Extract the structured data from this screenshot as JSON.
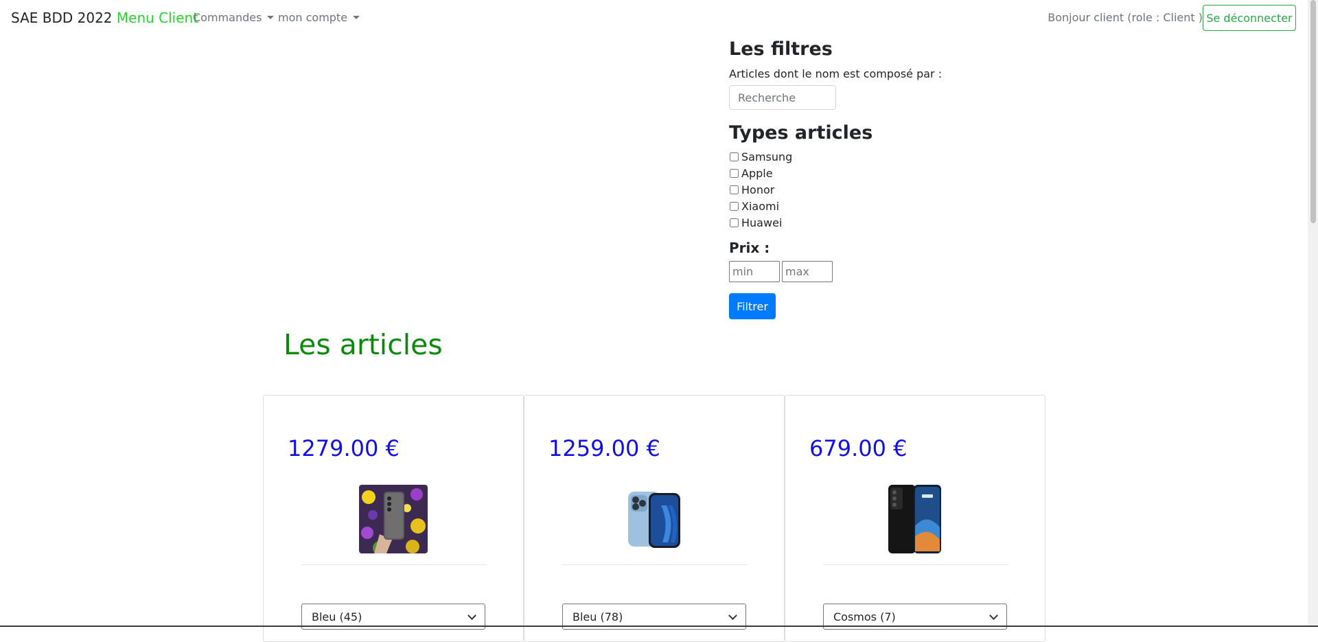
{
  "navbar": {
    "brand_main": "SAE BDD 2022",
    "brand_accent": "Menu Client",
    "menu_commandes": "Commandes",
    "menu_compte": "mon compte",
    "greeting": "Bonjour client (role : Client )",
    "logout_label": "Se déconnecter"
  },
  "filters": {
    "title": "Les filtres",
    "name_label": "Articles dont le nom est composé par :",
    "search_placeholder": "Recherche",
    "types_title": "Types articles",
    "types": [
      "Samsung",
      "Apple",
      "Honor",
      "Xiaomi",
      "Huawei"
    ],
    "price_title": "Prix :",
    "min_placeholder": "min",
    "max_placeholder": "max",
    "filter_button": "Filtrer"
  },
  "articles": {
    "title": "Les articles",
    "items": [
      {
        "price": "1279.00 €",
        "image": "samsung-phone-photo",
        "selected_color": "Bleu (45)"
      },
      {
        "price": "1259.00 €",
        "image": "iphone-photo",
        "selected_color": "Bleu (78)"
      },
      {
        "price": "679.00 €",
        "image": "huawei-phone-photo",
        "selected_color": "Cosmos (7)"
      }
    ]
  },
  "colors": {
    "brand_accent": "#1fd62a",
    "articles_title": "#0a8a0a",
    "price": "#1010e0",
    "primary_button": "#007bff",
    "logout_border": "#28a745"
  }
}
